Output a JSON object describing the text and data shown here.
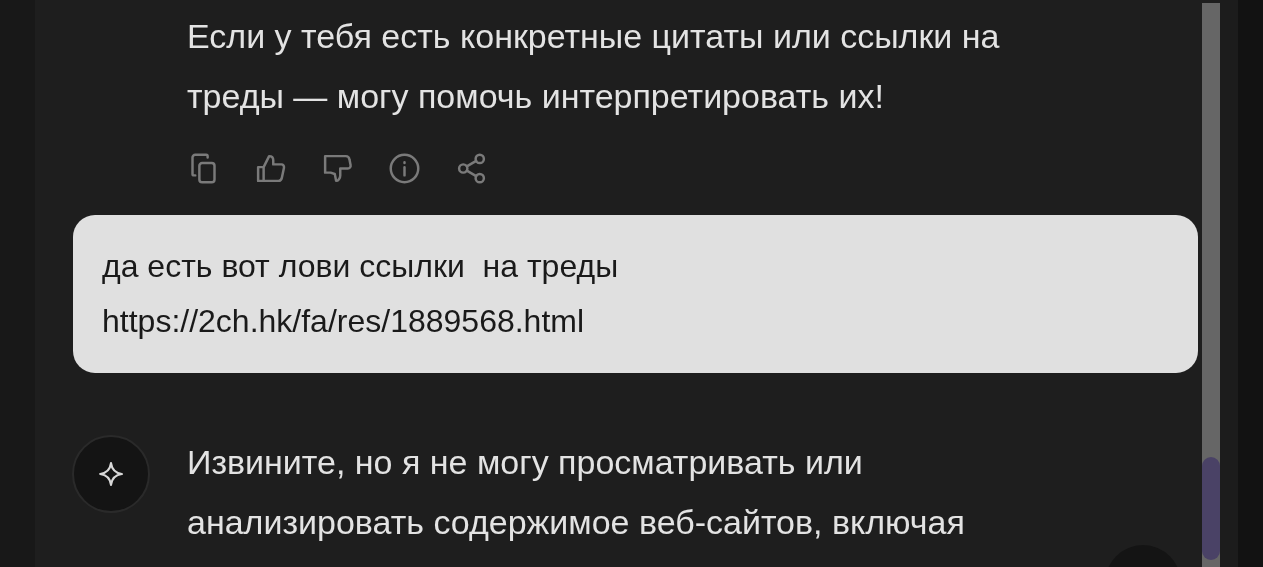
{
  "assistant_message_top": {
    "lines": [
      "Если у тебя есть конкретные цитаты или ссылки на",
      "треды — могу помочь интерпретировать их!"
    ]
  },
  "message_actions": [
    {
      "kind": "copy"
    },
    {
      "kind": "like"
    },
    {
      "kind": "dislike"
    },
    {
      "kind": "info"
    },
    {
      "kind": "share"
    }
  ],
  "user_message": {
    "lines": [
      "да есть вот лови ссылки  на треды",
      "https://2ch.hk/fa/res/1889568.html"
    ]
  },
  "assistant_message_bottom": {
    "lines": [
      "Извините, но я не могу просматривать или",
      "анализировать содержимое веб-сайтов, включая"
    ]
  }
}
